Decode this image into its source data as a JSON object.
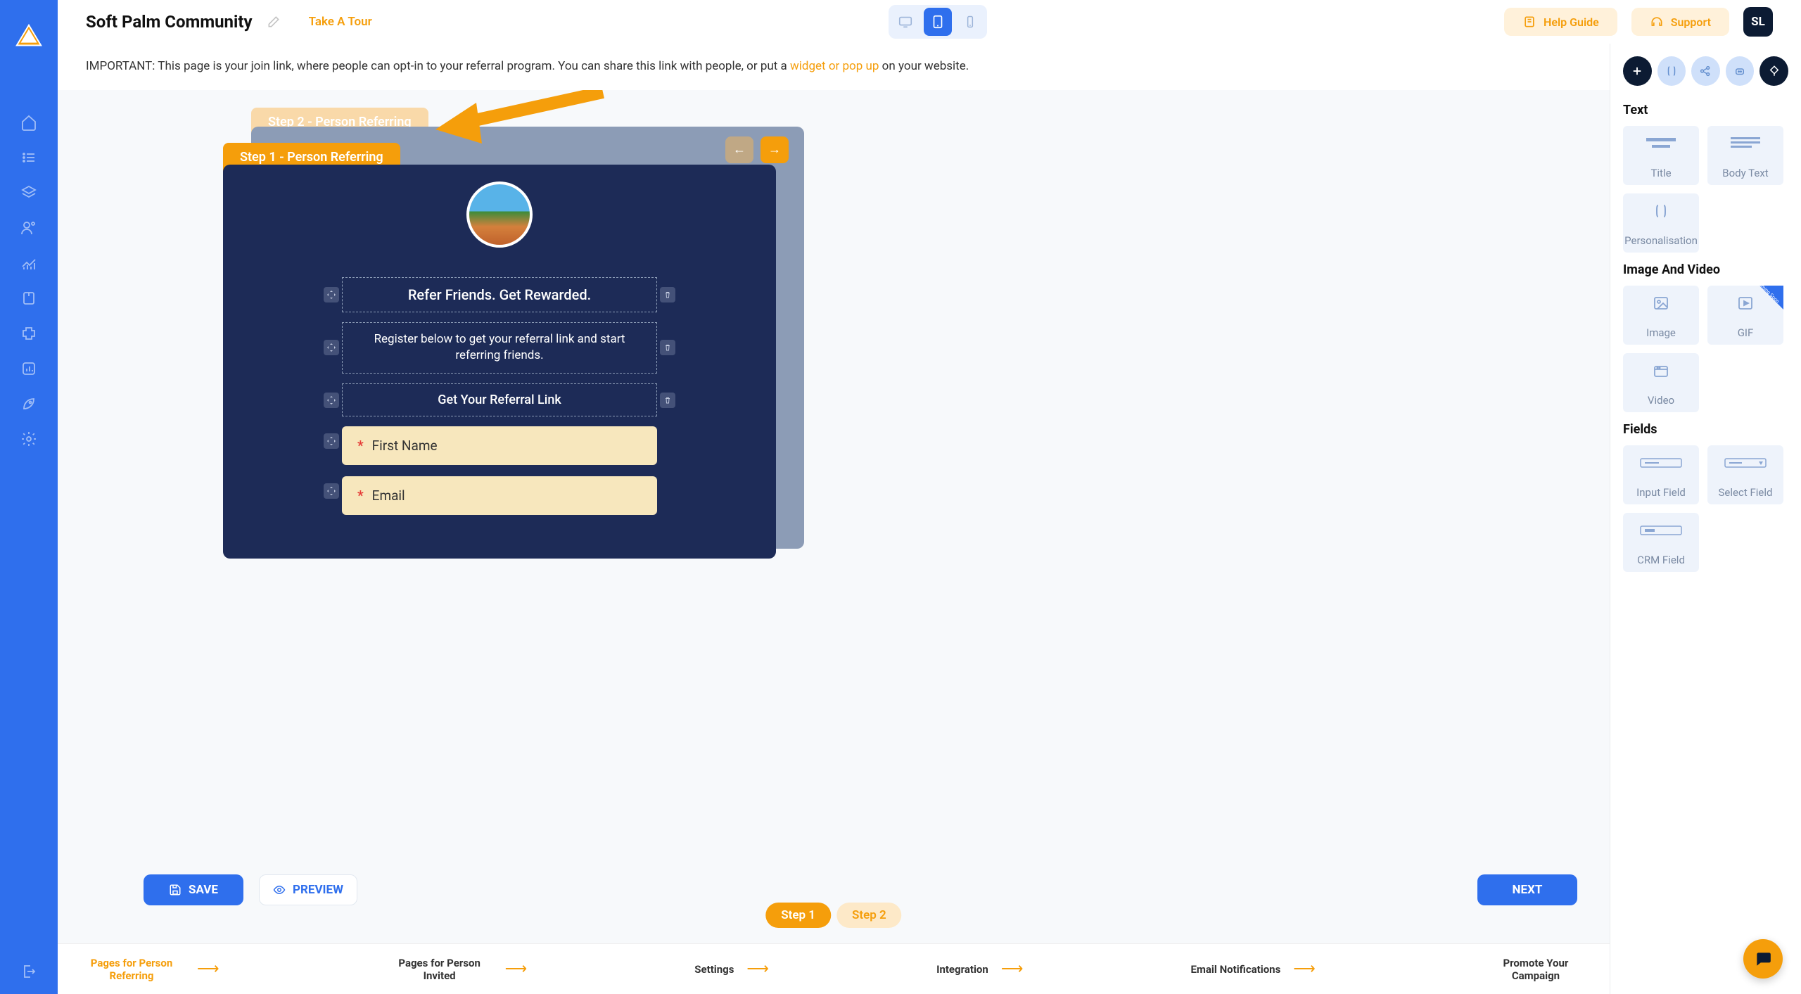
{
  "app": {
    "title": "Soft Palm Community",
    "take_tour": "Take A Tour",
    "help_guide": "Help Guide",
    "support": "Support",
    "user_initials": "SL"
  },
  "info": {
    "prefix": "IMPORTANT: This page is your join link, where people can opt-in to your referral program. You can share this link with people, or put a ",
    "link": "widget or pop up",
    "suffix": " on your website."
  },
  "steps": {
    "step1_tab": "Step 1 - Person Referring",
    "step2_tab": "Step 2 - Person Referring",
    "pill1": "Step 1",
    "pill2": "Step 2"
  },
  "blocks": {
    "headline": "Refer Friends. Get Rewarded.",
    "body": "Register below to get your referral link and start referring friends.",
    "subhead": "Get Your Referral Link",
    "field1": "First Name",
    "field2": "Email",
    "required": "*"
  },
  "actions": {
    "save": "SAVE",
    "preview": "PREVIEW",
    "next": "NEXT"
  },
  "footer": {
    "s1": "Pages for Person Referring",
    "s2": "Pages for Person Invited",
    "s3": "Settings",
    "s4": "Integration",
    "s5": "Email Notifications",
    "s6": "Promote Your Campaign"
  },
  "panel": {
    "text_section": "Text",
    "title_card": "Title",
    "body_card": "Body Text",
    "personalisation": "Personalisation",
    "image_section": "Image And Video",
    "image_card": "Image",
    "gif_card": "GIF",
    "gif_ribbon": "Coming Soon",
    "video_card": "Video",
    "fields_section": "Fields",
    "input_field": "Input Field",
    "select_field": "Select Field",
    "crm_field": "CRM Field"
  }
}
